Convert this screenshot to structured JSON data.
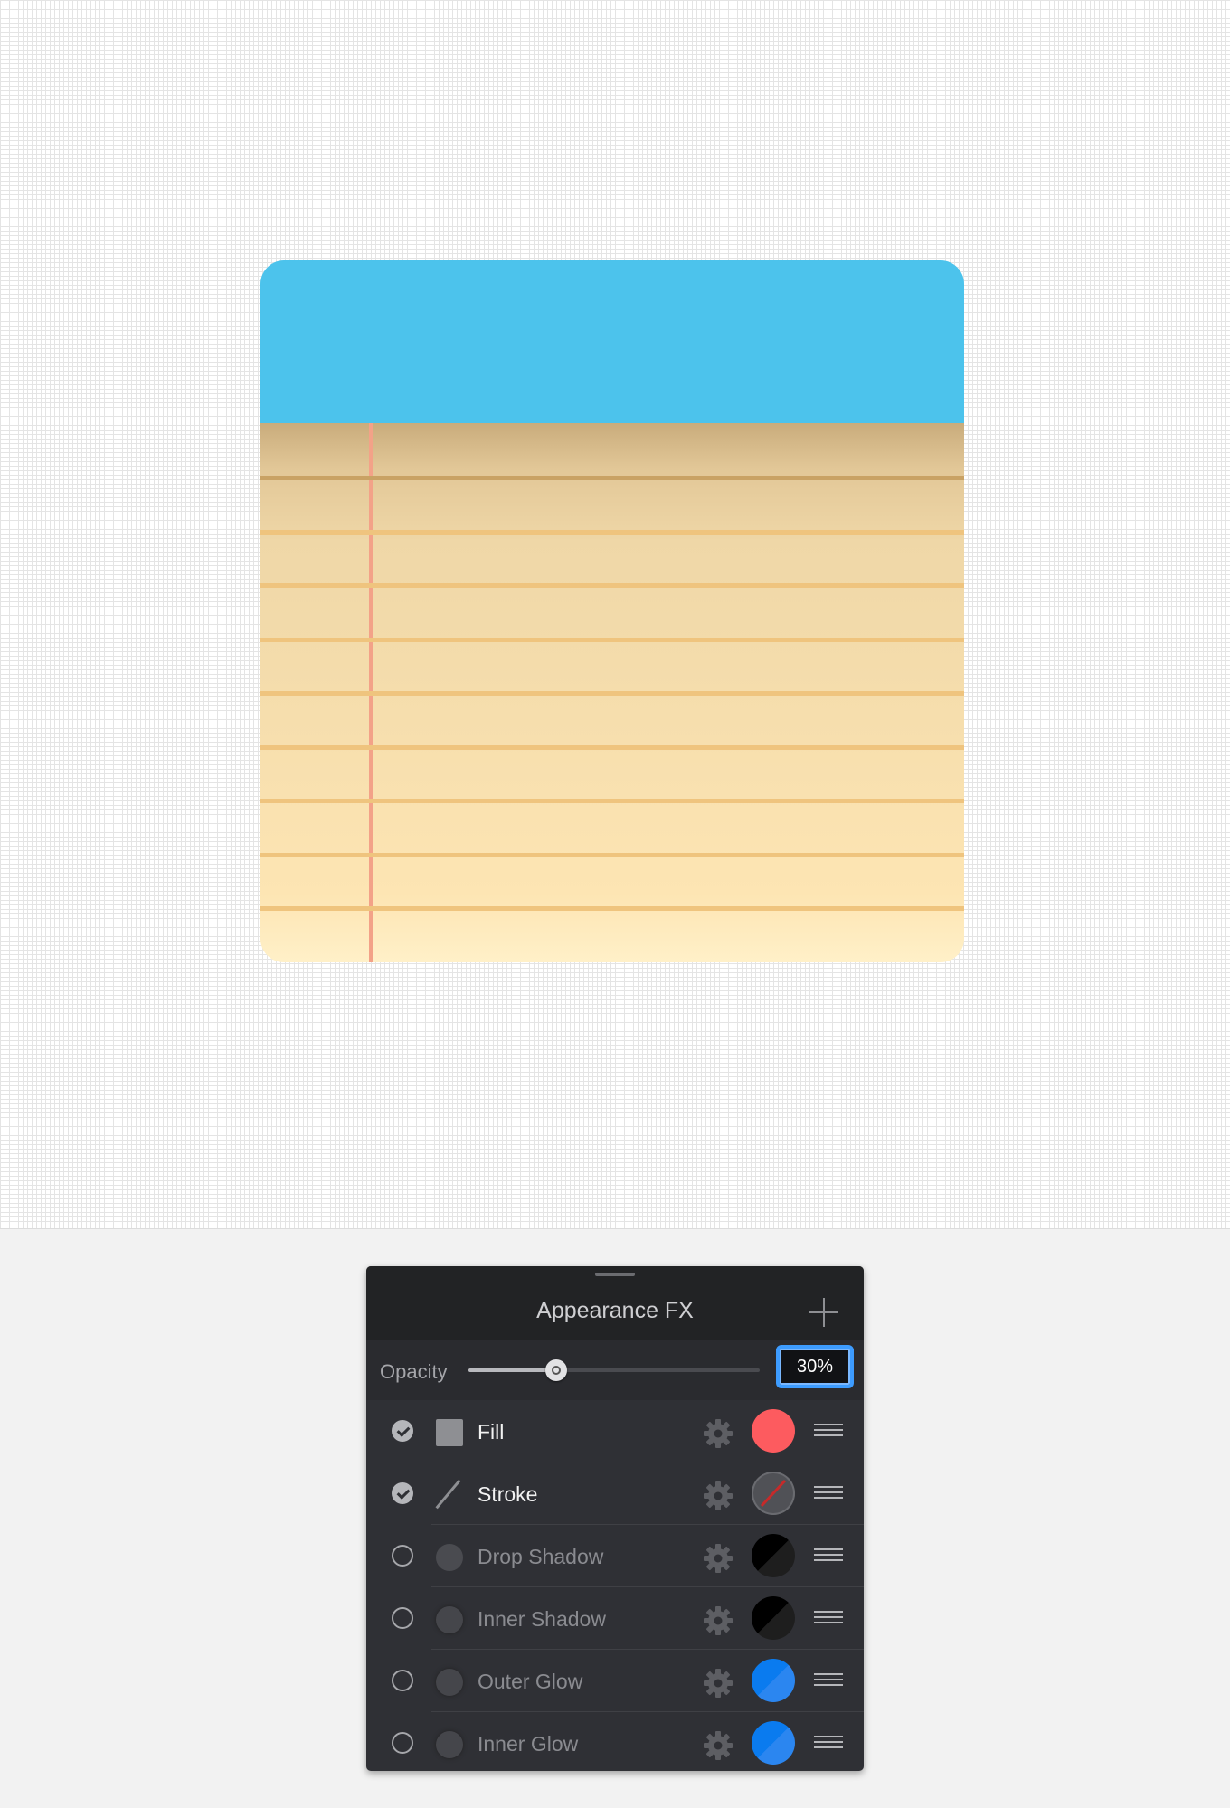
{
  "canvas": {
    "notepad": {
      "header_color": "#4cc3ec",
      "paper_line_color": "#efc47e",
      "margin_line_color": "#f3a288",
      "ruled_line_count": 9
    }
  },
  "panel": {
    "title": "Appearance FX",
    "add_icon": "plus-icon",
    "opacity": {
      "label": "Opacity",
      "value_text": "30%",
      "slider_fraction": 0.3
    },
    "effects": [
      {
        "label": "Fill",
        "enabled": true,
        "icon": "fill-square-icon",
        "swatch": "#fd5b5f"
      },
      {
        "label": "Stroke",
        "enabled": true,
        "icon": "stroke-line-icon",
        "swatch": "none"
      },
      {
        "label": "Drop Shadow",
        "enabled": false,
        "icon": "drop-shadow-icon",
        "swatch": "#000000"
      },
      {
        "label": "Inner Shadow",
        "enabled": false,
        "icon": "inner-shadow-icon",
        "swatch": "#000000"
      },
      {
        "label": "Outer Glow",
        "enabled": false,
        "icon": "outer-glow-icon",
        "swatch": "#0a7bef"
      },
      {
        "label": "Inner Glow",
        "enabled": false,
        "icon": "inner-glow-icon",
        "swatch": "#0a7bef"
      }
    ],
    "accent_color": "#3d9cff"
  }
}
